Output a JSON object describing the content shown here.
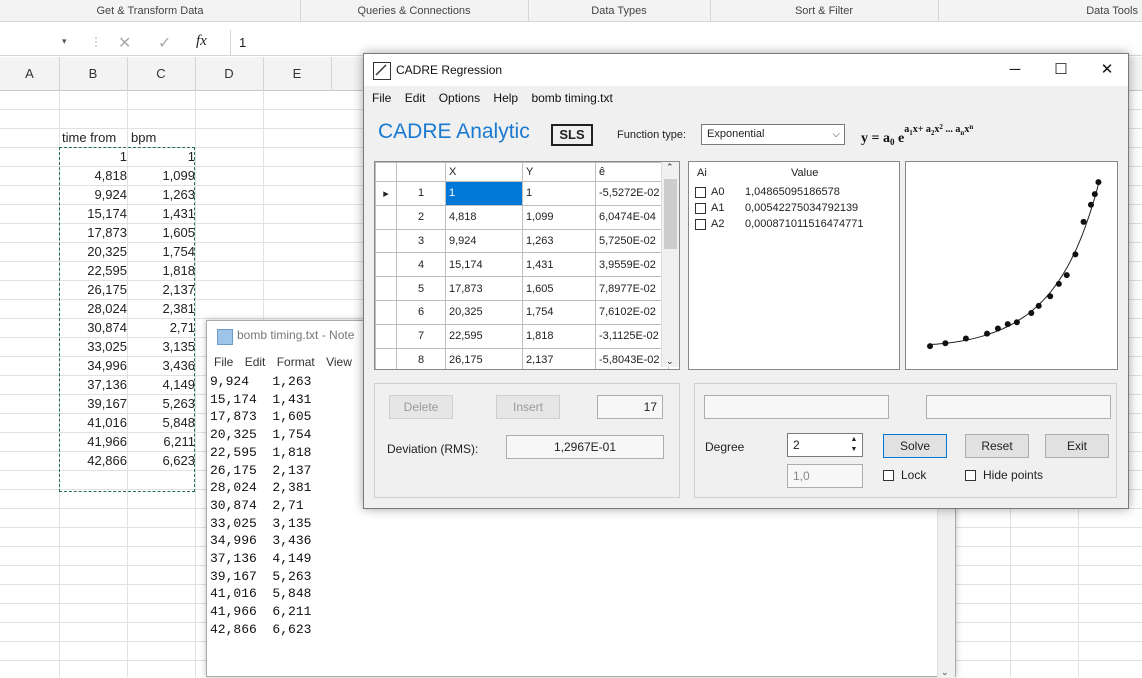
{
  "ribbon": {
    "groups": [
      "Get & Transform Data",
      "Queries & Connections",
      "Data Types",
      "Sort & Filter",
      "Data Tools"
    ]
  },
  "formula_bar": {
    "cancel": "✕",
    "enter": "✓",
    "fx": "fx",
    "value": "1"
  },
  "columns": [
    "A",
    "B",
    "C",
    "D",
    "E"
  ],
  "sheet": {
    "header_b": "time from",
    "header_c": "bpm",
    "rows": [
      [
        "1",
        "1"
      ],
      [
        "4,818",
        "1,099"
      ],
      [
        "9,924",
        "1,263"
      ],
      [
        "15,174",
        "1,431"
      ],
      [
        "17,873",
        "1,605"
      ],
      [
        "20,325",
        "1,754"
      ],
      [
        "22,595",
        "1,818"
      ],
      [
        "26,175",
        "2,137"
      ],
      [
        "28,024",
        "2,381"
      ],
      [
        "30,874",
        "2,71"
      ],
      [
        "33,025",
        "3,135"
      ],
      [
        "34,996",
        "3,436"
      ],
      [
        "37,136",
        "4,149"
      ],
      [
        "39,167",
        "5,263"
      ],
      [
        "41,016",
        "5,848"
      ],
      [
        "41,966",
        "6,211"
      ],
      [
        "42,866",
        "6,623"
      ]
    ]
  },
  "notepad": {
    "title": "bomb timing.txt - Note",
    "menu": [
      "File",
      "Edit",
      "Format",
      "View"
    ],
    "lines": "9,924   1,263\n15,174  1,431\n17,873  1,605\n20,325  1,754\n22,595  1,818\n26,175  2,137\n28,024  2,381\n30,874  2,71\n33,025  3,135\n34,996  3,436\n37,136  4,149\n39,167  5,263\n41,016  5,848\n41,966  6,211\n42,866  6,623"
  },
  "cadre": {
    "title": "CADRE Regression",
    "menu": [
      "File",
      "Edit",
      "Options",
      "Help",
      "bomb timing.txt"
    ],
    "brand": "CADRE Analytic",
    "mode": "SLS",
    "function_type_label": "Function type:",
    "function_type": "Exponential",
    "grid": {
      "headers": [
        "X",
        "Y",
        "ê"
      ],
      "rows": [
        [
          "1",
          "1",
          "1",
          "-5,5272E-02"
        ],
        [
          "2",
          "4,818",
          "1,099",
          "6,0474E-04"
        ],
        [
          "3",
          "9,924",
          "1,263",
          "5,7250E-02"
        ],
        [
          "4",
          "15,174",
          "1,431",
          "3,9559E-02"
        ],
        [
          "5",
          "17,873",
          "1,605",
          "7,8977E-02"
        ],
        [
          "6",
          "20,325",
          "1,754",
          "7,6102E-02"
        ],
        [
          "7",
          "22,595",
          "1,818",
          "-3,1125E-02"
        ],
        [
          "8",
          "26,175",
          "2,137",
          "-5,8043E-02"
        ]
      ]
    },
    "coefficients": {
      "header_ai": "Ai",
      "header_value": "Value",
      "rows": [
        {
          "name": "A0",
          "value": "1,04865095186578"
        },
        {
          "name": "A1",
          "value": "0,00542275034792139"
        },
        {
          "name": "A2",
          "value": "0,000871011516474771"
        }
      ]
    },
    "plot_points": [
      {
        "x": 1,
        "y": 1
      },
      {
        "x": 4.818,
        "y": 1.099
      },
      {
        "x": 9.924,
        "y": 1.263
      },
      {
        "x": 15.174,
        "y": 1.431
      },
      {
        "x": 17.873,
        "y": 1.605
      },
      {
        "x": 20.325,
        "y": 1.754
      },
      {
        "x": 22.595,
        "y": 1.818
      },
      {
        "x": 26.175,
        "y": 2.137
      },
      {
        "x": 28.024,
        "y": 2.381
      },
      {
        "x": 30.874,
        "y": 2.71
      },
      {
        "x": 33.025,
        "y": 3.135
      },
      {
        "x": 34.996,
        "y": 3.436
      },
      {
        "x": 37.136,
        "y": 4.149
      },
      {
        "x": 39.167,
        "y": 5.263
      },
      {
        "x": 41.016,
        "y": 5.848
      },
      {
        "x": 41.966,
        "y": 6.211
      },
      {
        "x": 42.866,
        "y": 6.623
      }
    ],
    "delete_label": "Delete",
    "insert_label": "Insert",
    "count": "17",
    "deviation_label": "Deviation (RMS):",
    "deviation": "1,2967E-01",
    "degree_label": "Degree",
    "degree": "2",
    "secondary": "1,0",
    "solve_label": "Solve",
    "reset_label": "Reset",
    "exit_label": "Exit",
    "lock_label": "Lock",
    "hide_points_label": "Hide points"
  }
}
